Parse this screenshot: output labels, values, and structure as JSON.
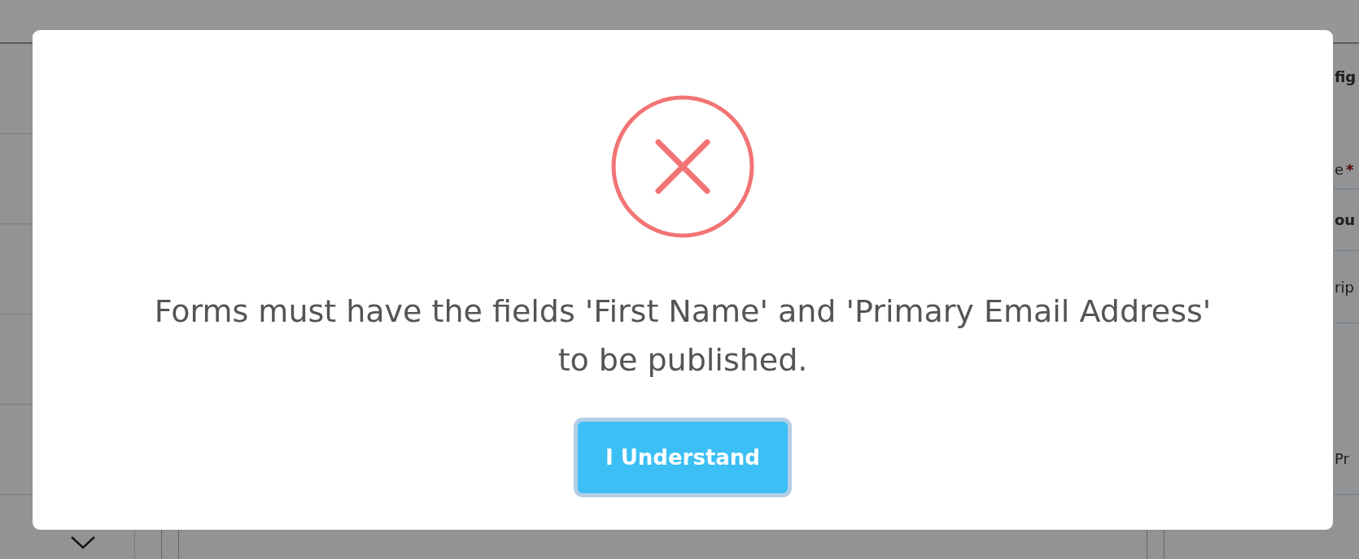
{
  "background": {
    "side_texts": [
      {
        "text": "fig",
        "kind": "heading"
      },
      {
        "text": "e",
        "kind": "label",
        "marker": "*"
      },
      {
        "text": "ou",
        "kind": "heading"
      },
      {
        "text": "rip",
        "kind": "label"
      },
      {
        "text": "Pr",
        "kind": "label"
      }
    ]
  },
  "dialog": {
    "message": "Forms must have the fields 'First Name' and 'Primary Email Address' to be published.",
    "button": "I Understand"
  }
}
